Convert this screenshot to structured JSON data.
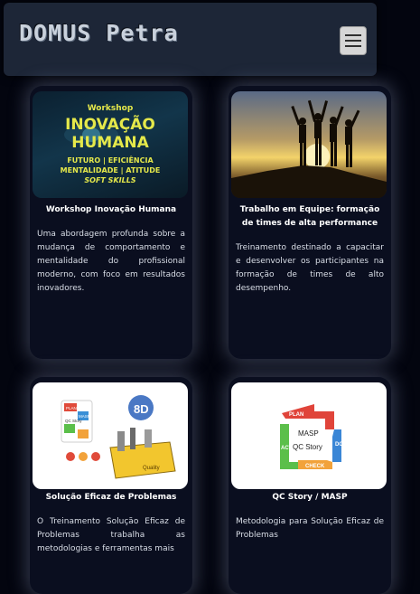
{
  "header": {
    "brand": "DOMUS Petra"
  },
  "cards": [
    {
      "title": "Workshop Inovação Humana",
      "description": "Uma abordagem profunda sobre a mudança de comportamento e mentalidade do profissional moderno, com foco em resultados inovadores.",
      "image": {
        "top_label": "Workshop",
        "headline_1": "INOVAÇÃO",
        "headline_2": "HUMANA",
        "line_1": "FUTURO | EFICIÊNCIA",
        "line_2": "MENTALIDADE | ATITUDE",
        "line_3": "SOFT SKILLS"
      }
    },
    {
      "title": "Trabalho em Equipe: formação de times de alta performance",
      "description": "Treinamento destinado a capacitar e desenvolver os participantes na formação de times de alto desempenho."
    },
    {
      "title": "Solução Eficaz de Problemas",
      "description": "O Treinamento Solução Eficaz de Problemas trabalha as metodologias e ferramentas mais",
      "image": {
        "badge": "8D",
        "mini_1": "PLAN",
        "mini_2": "MASP",
        "mini_3": "QC Story",
        "tool_label": "Quality"
      }
    },
    {
      "title": "QC Story / MASP",
      "description": "Metodologia para Solução Eficaz de Problemas",
      "image": {
        "plan": "PLAN",
        "do": "DO",
        "check": "CHECK",
        "act": "ACT",
        "center_1": "MASP",
        "center_2": "QC Story"
      }
    }
  ]
}
